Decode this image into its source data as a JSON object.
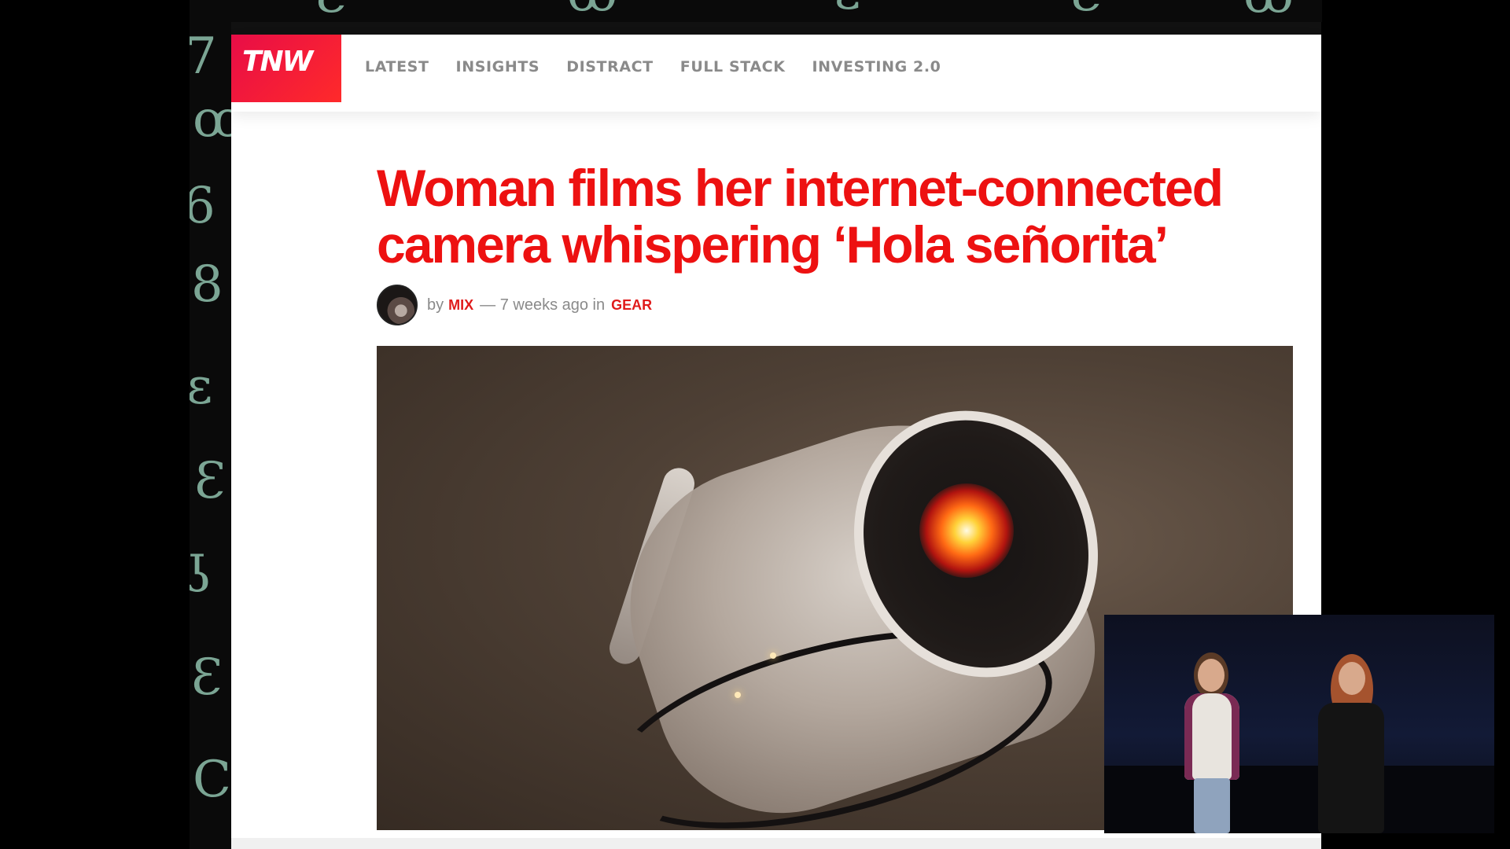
{
  "nav": {
    "logo": "TNW",
    "items": [
      "LATEST",
      "INSIGHTS",
      "DISTRACT",
      "FULL STACK",
      "INVESTING 2.0"
    ]
  },
  "article": {
    "title": "Woman films her internet-connected camera whispering ‘Hola señorita’",
    "byline_by": "by",
    "author": "MIX",
    "byline_mid": "— 7 weeks ago in",
    "category": "GEAR"
  },
  "colors": {
    "brand_red": "#ed1111",
    "logo_gradient_start": "#e80d47",
    "nav_text": "#8a8a8a"
  },
  "icons": {
    "avatar": "author-avatar",
    "hero": "security-camera-photo"
  }
}
